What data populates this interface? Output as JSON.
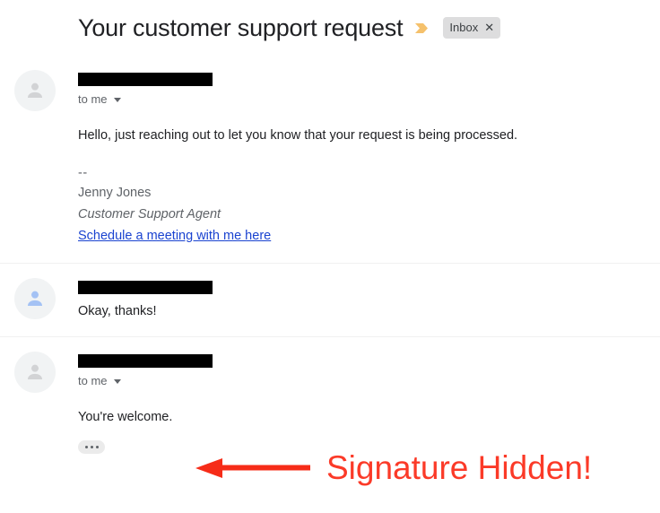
{
  "header": {
    "subject": "Your customer support request",
    "important_marker_icon": "important-marker-icon",
    "label": "Inbox",
    "label_close_icon": "✕"
  },
  "thread": {
    "messages": [
      {
        "avatar_icon": "person-avatar-icon",
        "avatar_variant": "gray",
        "sender_redacted": true,
        "recipient": "to me",
        "recipient_caret_icon": "chevron-down-icon",
        "body": "Hello, just reaching out to let you know that your request is being processed.",
        "signature": {
          "separator": "--",
          "name": "Jenny Jones",
          "role": "Customer Support Agent",
          "link": "Schedule a meeting with me here"
        },
        "has_trimmed_content": false
      },
      {
        "avatar_icon": "person-avatar-icon",
        "avatar_variant": "blue",
        "sender_redacted": true,
        "recipient": null,
        "body": "Okay, thanks!",
        "signature": null,
        "has_trimmed_content": false
      },
      {
        "avatar_icon": "person-avatar-icon",
        "avatar_variant": "gray",
        "sender_redacted": true,
        "recipient": "to me",
        "recipient_caret_icon": "chevron-down-icon",
        "body": "You're welcome.",
        "signature": null,
        "has_trimmed_content": true,
        "trimmed_content_label": "•••"
      }
    ]
  },
  "annotation": {
    "text": "Signature Hidden!",
    "color": "#fb3a28",
    "arrow_icon": "left-arrow-icon",
    "arrow_direction": "left"
  },
  "colors": {
    "link": "#1a43d0",
    "label_chip_bg": "#ddddde",
    "important_marker": "#f5c16c",
    "avatar_bg": "#f1f3f4",
    "avatar_glyph_gray": "#d2d3d5",
    "avatar_glyph_blue": "#a4c2f4",
    "annotation_red": "#fb3a28",
    "redaction": "#000000"
  }
}
